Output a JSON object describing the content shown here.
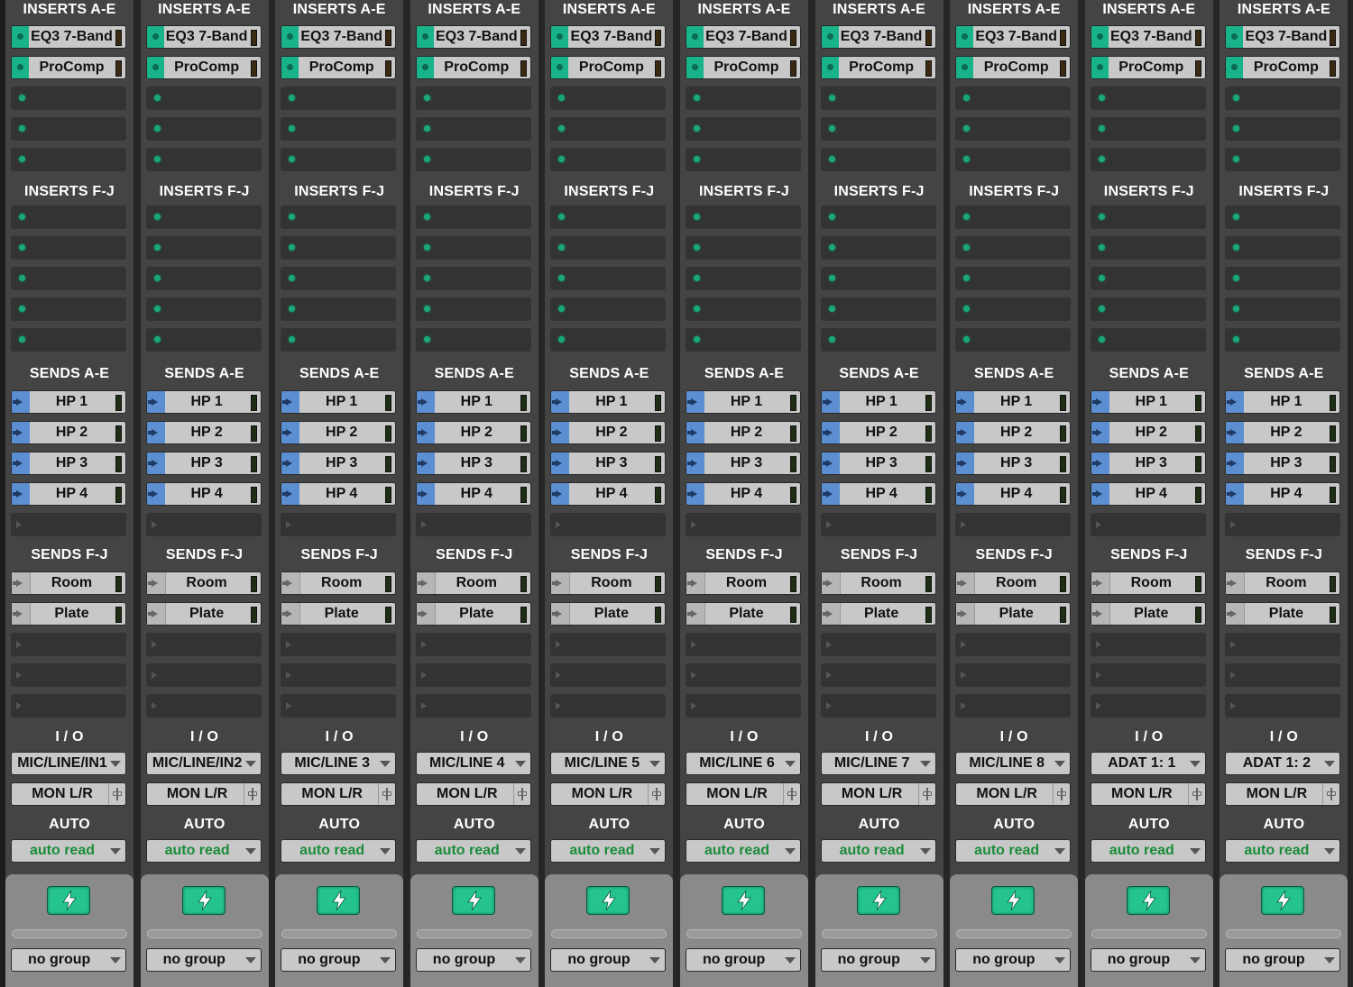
{
  "colors": {
    "strip_bg": "#444444",
    "slot_empty": "#333333",
    "button_gray": "#c8c8c8",
    "insert_green": "#19b38a",
    "send_blue": "#5b8fd1",
    "auto_text_green": "#1a8c3a",
    "power_green": "#25c48d"
  },
  "icons": {
    "insert_active": "green-dot-icon",
    "send_arrow": "send-arrow-icon",
    "dropdown": "chevron-down-icon",
    "output_path": "plug-icon",
    "power": "lightning-bolt-icon"
  },
  "strips": [
    {
      "inserts_ae_title": "INSERTS A-E",
      "inserts_fj_title": "INSERTS F-J",
      "sends_ae_title": "SENDS A-E",
      "sends_fj_title": "SENDS F-J",
      "io_title": "I / O",
      "auto_title": "AUTO",
      "inserts": [
        "EQ3 7-Band",
        "ProComp"
      ],
      "sends_ae": [
        "HP 1",
        "HP 2",
        "HP 3",
        "HP 4"
      ],
      "sends_fj": [
        "Room",
        "Plate"
      ],
      "input": "MIC/LINE/IN1",
      "output": "MON L/R",
      "auto_mode": "auto read",
      "group": "no group"
    },
    {
      "inserts_ae_title": "INSERTS A-E",
      "inserts_fj_title": "INSERTS F-J",
      "sends_ae_title": "SENDS A-E",
      "sends_fj_title": "SENDS F-J",
      "io_title": "I / O",
      "auto_title": "AUTO",
      "inserts": [
        "EQ3 7-Band",
        "ProComp"
      ],
      "sends_ae": [
        "HP 1",
        "HP 2",
        "HP 3",
        "HP 4"
      ],
      "sends_fj": [
        "Room",
        "Plate"
      ],
      "input": "MIC/LINE/IN2",
      "output": "MON L/R",
      "auto_mode": "auto read",
      "group": "no group"
    },
    {
      "inserts_ae_title": "INSERTS A-E",
      "inserts_fj_title": "INSERTS F-J",
      "sends_ae_title": "SENDS A-E",
      "sends_fj_title": "SENDS F-J",
      "io_title": "I / O",
      "auto_title": "AUTO",
      "inserts": [
        "EQ3 7-Band",
        "ProComp"
      ],
      "sends_ae": [
        "HP 1",
        "HP 2",
        "HP 3",
        "HP 4"
      ],
      "sends_fj": [
        "Room",
        "Plate"
      ],
      "input": "MIC/LINE 3",
      "output": "MON L/R",
      "auto_mode": "auto read",
      "group": "no group"
    },
    {
      "inserts_ae_title": "INSERTS A-E",
      "inserts_fj_title": "INSERTS F-J",
      "sends_ae_title": "SENDS A-E",
      "sends_fj_title": "SENDS F-J",
      "io_title": "I / O",
      "auto_title": "AUTO",
      "inserts": [
        "EQ3 7-Band",
        "ProComp"
      ],
      "sends_ae": [
        "HP 1",
        "HP 2",
        "HP 3",
        "HP 4"
      ],
      "sends_fj": [
        "Room",
        "Plate"
      ],
      "input": "MIC/LINE 4",
      "output": "MON L/R",
      "auto_mode": "auto read",
      "group": "no group"
    },
    {
      "inserts_ae_title": "INSERTS A-E",
      "inserts_fj_title": "INSERTS F-J",
      "sends_ae_title": "SENDS A-E",
      "sends_fj_title": "SENDS F-J",
      "io_title": "I / O",
      "auto_title": "AUTO",
      "inserts": [
        "EQ3 7-Band",
        "ProComp"
      ],
      "sends_ae": [
        "HP 1",
        "HP 2",
        "HP 3",
        "HP 4"
      ],
      "sends_fj": [
        "Room",
        "Plate"
      ],
      "input": "MIC/LINE 5",
      "output": "MON L/R",
      "auto_mode": "auto read",
      "group": "no group"
    },
    {
      "inserts_ae_title": "INSERTS A-E",
      "inserts_fj_title": "INSERTS F-J",
      "sends_ae_title": "SENDS A-E",
      "sends_fj_title": "SENDS F-J",
      "io_title": "I / O",
      "auto_title": "AUTO",
      "inserts": [
        "EQ3 7-Band",
        "ProComp"
      ],
      "sends_ae": [
        "HP 1",
        "HP 2",
        "HP 3",
        "HP 4"
      ],
      "sends_fj": [
        "Room",
        "Plate"
      ],
      "input": "MIC/LINE 6",
      "output": "MON L/R",
      "auto_mode": "auto read",
      "group": "no group"
    },
    {
      "inserts_ae_title": "INSERTS A-E",
      "inserts_fj_title": "INSERTS F-J",
      "sends_ae_title": "SENDS A-E",
      "sends_fj_title": "SENDS F-J",
      "io_title": "I / O",
      "auto_title": "AUTO",
      "inserts": [
        "EQ3 7-Band",
        "ProComp"
      ],
      "sends_ae": [
        "HP 1",
        "HP 2",
        "HP 3",
        "HP 4"
      ],
      "sends_fj": [
        "Room",
        "Plate"
      ],
      "input": "MIC/LINE 7",
      "output": "MON L/R",
      "auto_mode": "auto read",
      "group": "no group"
    },
    {
      "inserts_ae_title": "INSERTS A-E",
      "inserts_fj_title": "INSERTS F-J",
      "sends_ae_title": "SENDS A-E",
      "sends_fj_title": "SENDS F-J",
      "io_title": "I / O",
      "auto_title": "AUTO",
      "inserts": [
        "EQ3 7-Band",
        "ProComp"
      ],
      "sends_ae": [
        "HP 1",
        "HP 2",
        "HP 3",
        "HP 4"
      ],
      "sends_fj": [
        "Room",
        "Plate"
      ],
      "input": "MIC/LINE 8",
      "output": "MON L/R",
      "auto_mode": "auto read",
      "group": "no group"
    },
    {
      "inserts_ae_title": "INSERTS A-E",
      "inserts_fj_title": "INSERTS F-J",
      "sends_ae_title": "SENDS A-E",
      "sends_fj_title": "SENDS F-J",
      "io_title": "I / O",
      "auto_title": "AUTO",
      "inserts": [
        "EQ3 7-Band",
        "ProComp"
      ],
      "sends_ae": [
        "HP 1",
        "HP 2",
        "HP 3",
        "HP 4"
      ],
      "sends_fj": [
        "Room",
        "Plate"
      ],
      "input": "ADAT 1: 1",
      "output": "MON L/R",
      "auto_mode": "auto read",
      "group": "no group"
    },
    {
      "inserts_ae_title": "INSERTS A-E",
      "inserts_fj_title": "INSERTS F-J",
      "sends_ae_title": "SENDS A-E",
      "sends_fj_title": "SENDS F-J",
      "io_title": "I / O",
      "auto_title": "AUTO",
      "inserts": [
        "EQ3 7-Band",
        "ProComp"
      ],
      "sends_ae": [
        "HP 1",
        "HP 2",
        "HP 3",
        "HP 4"
      ],
      "sends_fj": [
        "Room",
        "Plate"
      ],
      "input": "ADAT 1: 2",
      "output": "MON L/R",
      "auto_mode": "auto read",
      "group": "no group"
    }
  ]
}
